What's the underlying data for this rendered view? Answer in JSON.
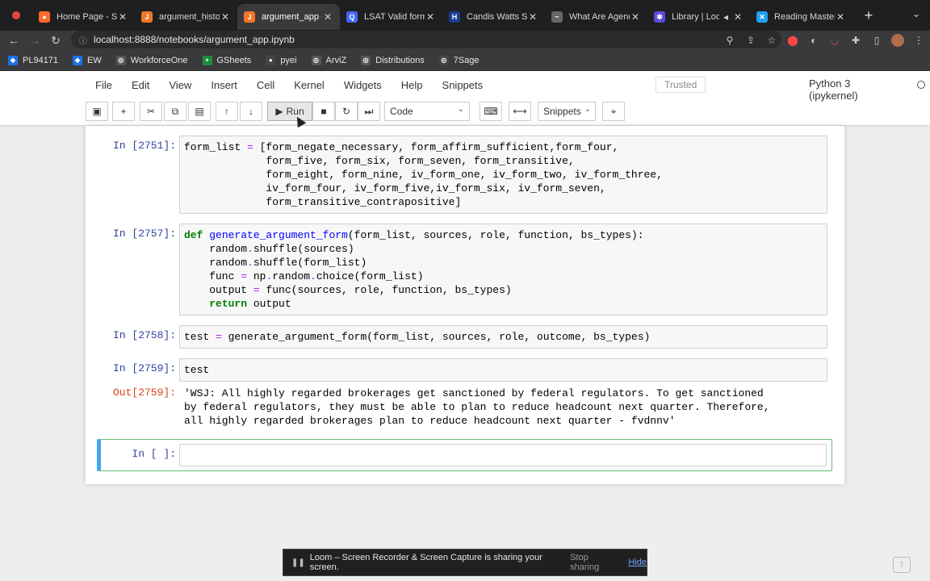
{
  "browser": {
    "tabs": [
      {
        "title": "Home Page - Se",
        "icon": "firefox-icon",
        "color": "#ff6b2b"
      },
      {
        "title": "argument_histor",
        "icon": "jupyter-icon",
        "color": "#f37626"
      },
      {
        "title": "argument_app -",
        "icon": "jupyter-icon",
        "color": "#f37626",
        "active": true
      },
      {
        "title": "LSAT Valid form :",
        "icon": "search-icon",
        "color": "#4466ff"
      },
      {
        "title": "Candis Watts Sm",
        "icon": "book-icon",
        "color": "#1a3d8f"
      },
      {
        "title": "What Are Agency",
        "icon": "bird-icon",
        "color": "#666666"
      },
      {
        "title": "Library | Loo",
        "icon": "gear-icon",
        "color": "#5b4bdb"
      },
      {
        "title": "Reading Mastery",
        "icon": "x-icon",
        "color": "#1da1f2"
      }
    ],
    "url": "localhost:8888/notebooks/argument_app.ipynb",
    "bookmarks": [
      {
        "label": "PL94171",
        "color": "#1a73e8"
      },
      {
        "label": "EW",
        "color": "#1a73e8"
      },
      {
        "label": "WorkforceOne",
        "color": "#555555"
      },
      {
        "label": "GSheets",
        "color": "#1e8e3e"
      },
      {
        "label": "pyei",
        "color": "#444444"
      },
      {
        "label": "ArviZ",
        "color": "#555555"
      },
      {
        "label": "Distributions",
        "color": "#555555"
      },
      {
        "label": "7Sage",
        "color": "#444444"
      }
    ]
  },
  "jupyter": {
    "menu": [
      "File",
      "Edit",
      "View",
      "Insert",
      "Cell",
      "Kernel",
      "Widgets",
      "Help",
      "Snippets"
    ],
    "trusted": "Trusted",
    "kernel": "Python 3 (ipykernel)",
    "run_label": "Run",
    "cell_type": "Code",
    "snippets": "Snippets"
  },
  "cells": {
    "c1": {
      "prompt": "In [2751]:"
    },
    "c2": {
      "prompt": "In [2757]:"
    },
    "c3": {
      "prompt": "In [2758]:"
    },
    "c4": {
      "prompt": "In [2759]:",
      "line": "test"
    },
    "out": {
      "prompt": "Out[2759]:",
      "text": "'WSJ: All highly regarded brokerages get sanctioned by federal regulators. To get sanctioned\nby federal regulators, they must be able to plan to reduce headcount next quarter. Therefore,\nall highly regarded brokerages plan to reduce headcount next quarter - fvdnnv'"
    },
    "empty": {
      "prompt": "In [ ]:"
    }
  },
  "loom": {
    "message": "Loom – Screen Recorder & Screen Capture is sharing your screen.",
    "stop": "Stop sharing",
    "hide": "Hide"
  }
}
